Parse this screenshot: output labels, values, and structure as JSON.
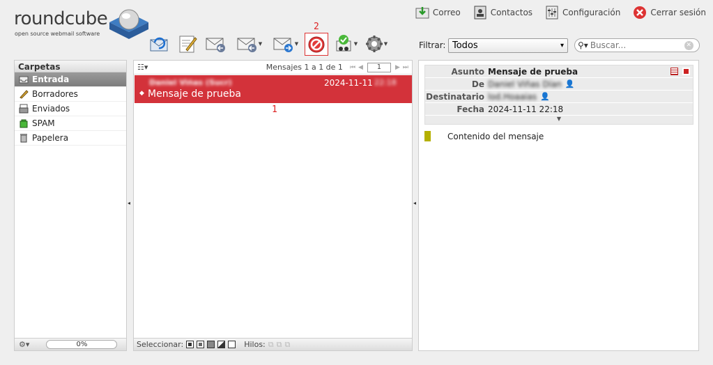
{
  "logo": {
    "word": "roundcube",
    "tagline": "open source webmail software"
  },
  "topnav": [
    {
      "label": "Correo",
      "icon": "mail-download-icon"
    },
    {
      "label": "Contactos",
      "icon": "address-book-icon"
    },
    {
      "label": "Configuración",
      "icon": "settings-panel-icon"
    },
    {
      "label": "Cerrar sesión",
      "icon": "logout-icon"
    }
  ],
  "annotations": {
    "spam_number": "2",
    "message_number": "1"
  },
  "filter": {
    "label": "Filtrar:",
    "value": "Todos"
  },
  "search": {
    "placeholder": "Buscar..."
  },
  "folders": {
    "header": "Carpetas",
    "items": [
      {
        "label": "Entrada",
        "icon": "inbox-icon",
        "selected": true
      },
      {
        "label": "Borradores",
        "icon": "pencil-icon",
        "selected": false
      },
      {
        "label": "Enviados",
        "icon": "sent-icon",
        "selected": false
      },
      {
        "label": "SPAM",
        "icon": "spam-icon",
        "selected": false
      },
      {
        "label": "Papelera",
        "icon": "trash-icon",
        "selected": false
      }
    ],
    "quota": "0%"
  },
  "messagelist": {
    "count_text": "Mensajes 1 a 1 de 1",
    "page": "1",
    "messages": [
      {
        "from": "Daniel Viñas (Sucr)",
        "date": "2024-11-11",
        "time": "22:18",
        "subject": "Mensaje de prueba"
      }
    ],
    "footer": {
      "select_label": "Seleccionar:",
      "threads_label": "Hilos:"
    }
  },
  "preview": {
    "headers": [
      {
        "key": "Asunto",
        "value": "Mensaje de prueba",
        "blurred": false
      },
      {
        "key": "De",
        "value": "Daniel Viñas Dían",
        "blurred": true
      },
      {
        "key": "Destinatario",
        "value": "lod.Hoaaias",
        "blurred": true
      },
      {
        "key": "Fecha",
        "value": "2024-11-11 22:18",
        "blurred": false
      }
    ],
    "body": "Contenido del mensaje",
    "accent_color": "#b5b000"
  }
}
